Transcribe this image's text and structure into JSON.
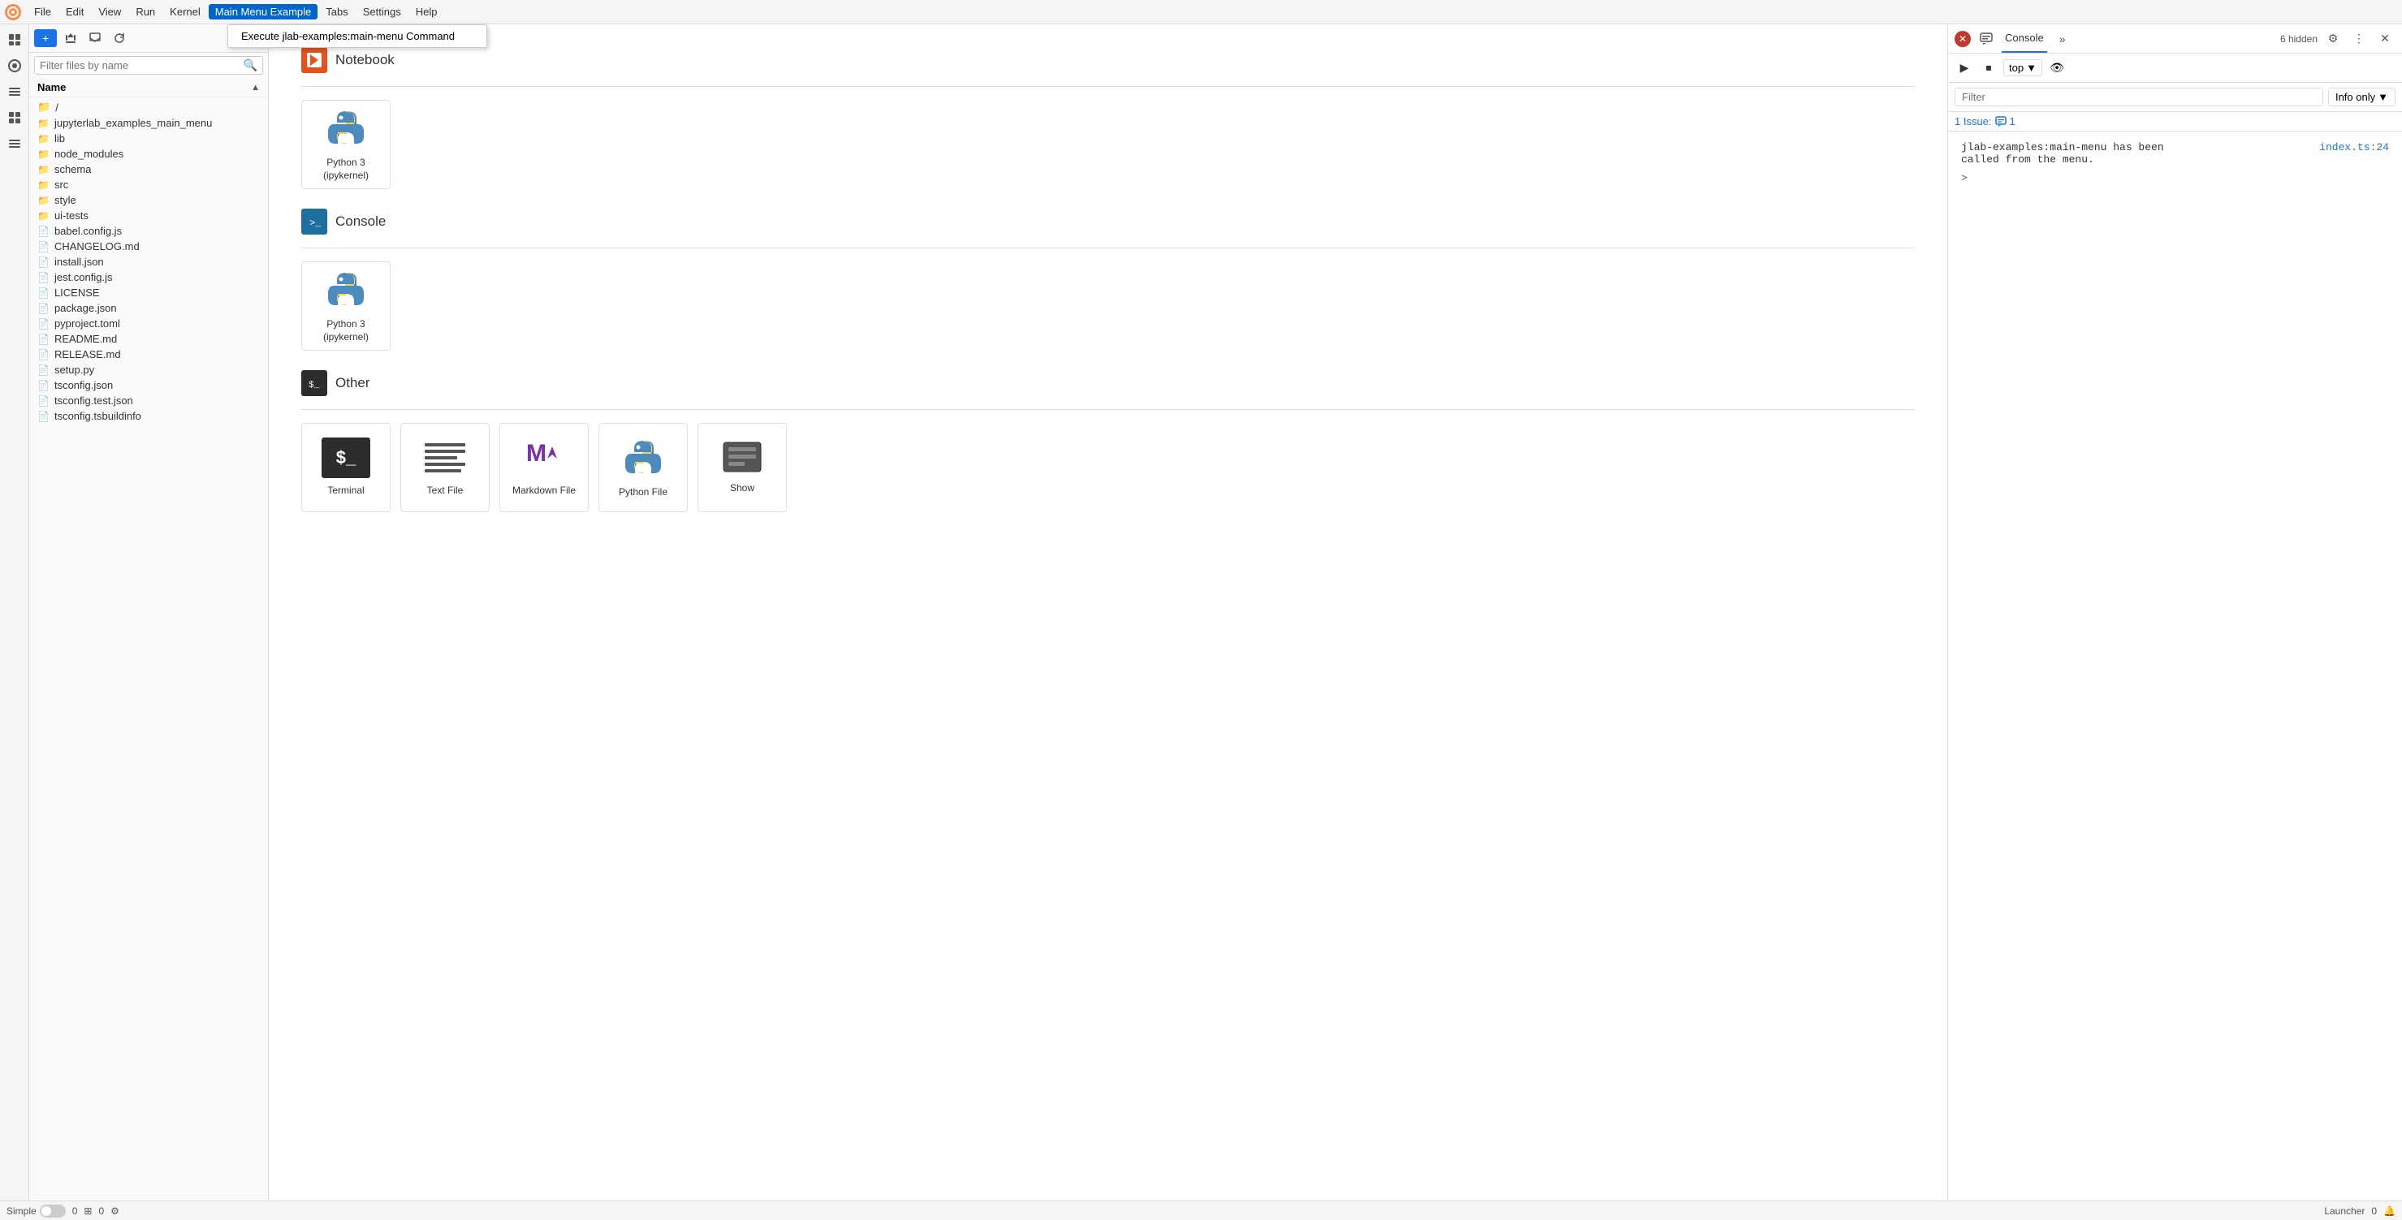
{
  "menubar": {
    "logo_label": "JupyterLab",
    "items": [
      "File",
      "Edit",
      "View",
      "Run",
      "Kernel",
      "Main Menu Example",
      "Tabs",
      "Settings",
      "Help"
    ],
    "active_item": "Main Menu Example",
    "dropdown": {
      "visible": true,
      "item": "Execute jlab-examples:main-menu Command"
    }
  },
  "sidebar_icons": {
    "icons": [
      {
        "name": "files-icon",
        "symbol": "📁",
        "active": true
      },
      {
        "name": "running-icon",
        "symbol": "⬤",
        "active": false
      },
      {
        "name": "commands-icon",
        "symbol": "⌘",
        "active": false
      },
      {
        "name": "extension-icon",
        "symbol": "🔌",
        "active": false
      },
      {
        "name": "menu-icon",
        "symbol": "☰",
        "active": false
      }
    ]
  },
  "file_panel": {
    "toolbar": {
      "new_button": "+",
      "upload_icon": "⬆",
      "refresh_icon": "↻"
    },
    "search_placeholder": "Filter files by name",
    "header": {
      "name_label": "Name",
      "sort_icon": "▲"
    },
    "files": [
      {
        "name": "/",
        "type": "root",
        "icon": "📁"
      },
      {
        "name": "jupyterlab_examples_main_menu",
        "type": "folder",
        "icon": "📁"
      },
      {
        "name": "lib",
        "type": "folder",
        "icon": "📁"
      },
      {
        "name": "node_modules",
        "type": "folder",
        "icon": "📁"
      },
      {
        "name": "schema",
        "type": "folder",
        "icon": "📁"
      },
      {
        "name": "src",
        "type": "folder",
        "icon": "📁"
      },
      {
        "name": "style",
        "type": "folder",
        "icon": "📁"
      },
      {
        "name": "ui-tests",
        "type": "folder",
        "icon": "📁"
      },
      {
        "name": "babel.config.js",
        "type": "js",
        "icon": "📄"
      },
      {
        "name": "CHANGELOG.md",
        "type": "md",
        "icon": "📄"
      },
      {
        "name": "install.json",
        "type": "json",
        "icon": "📄"
      },
      {
        "name": "jest.config.js",
        "type": "js",
        "icon": "📄"
      },
      {
        "name": "LICENSE",
        "type": "file",
        "icon": "📄"
      },
      {
        "name": "package.json",
        "type": "json",
        "icon": "📄"
      },
      {
        "name": "pyproject.toml",
        "type": "file",
        "icon": "📄"
      },
      {
        "name": "README.md",
        "type": "md",
        "icon": "📄"
      },
      {
        "name": "RELEASE.md",
        "type": "md",
        "icon": "📄"
      },
      {
        "name": "setup.py",
        "type": "py",
        "icon": "📄"
      },
      {
        "name": "tsconfig.json",
        "type": "json",
        "icon": "📄"
      },
      {
        "name": "tsconfig.test.json",
        "type": "json",
        "icon": "📄"
      },
      {
        "name": "tsconfig.tsbuildinfo",
        "type": "file",
        "icon": "📄"
      }
    ]
  },
  "launcher": {
    "tab_title": "Launcher",
    "sections": [
      {
        "name": "Notebook",
        "icon_type": "notebook",
        "cards": [
          {
            "label": "Python 3\n(ipykernel)",
            "icon_type": "python"
          }
        ]
      },
      {
        "name": "Console",
        "icon_type": "console",
        "cards": [
          {
            "label": "Python 3\n(ipykernel)",
            "icon_type": "python"
          }
        ]
      },
      {
        "name": "Other",
        "icon_type": "other",
        "cards": [
          {
            "label": "Terminal",
            "icon_type": "terminal"
          },
          {
            "label": "Text File",
            "icon_type": "textfile"
          },
          {
            "label": "Markdown File",
            "icon_type": "markdown"
          },
          {
            "label": "Python File",
            "icon_type": "python"
          },
          {
            "label": "Show",
            "icon_type": "show"
          }
        ]
      }
    ]
  },
  "right_panel": {
    "title": "Console",
    "hidden_count": "6 hidden",
    "toolbar": {
      "top_label": "top",
      "run_label": "▶",
      "stop_label": "⏹"
    },
    "filter": {
      "placeholder": "Filter",
      "info_only_label": "Info only"
    },
    "issues": {
      "count_label": "1 Issue:",
      "message_count": "1"
    },
    "console_messages": [
      {
        "text": "jlab-examples:main-menu has been\n    called from the menu.",
        "link": "index.ts:24"
      }
    ],
    "prompt": ">"
  },
  "status_bar": {
    "mode_label": "Simple",
    "left_count": "0",
    "middle_count": "0",
    "tab_label": "Launcher",
    "bell_count": "0"
  }
}
